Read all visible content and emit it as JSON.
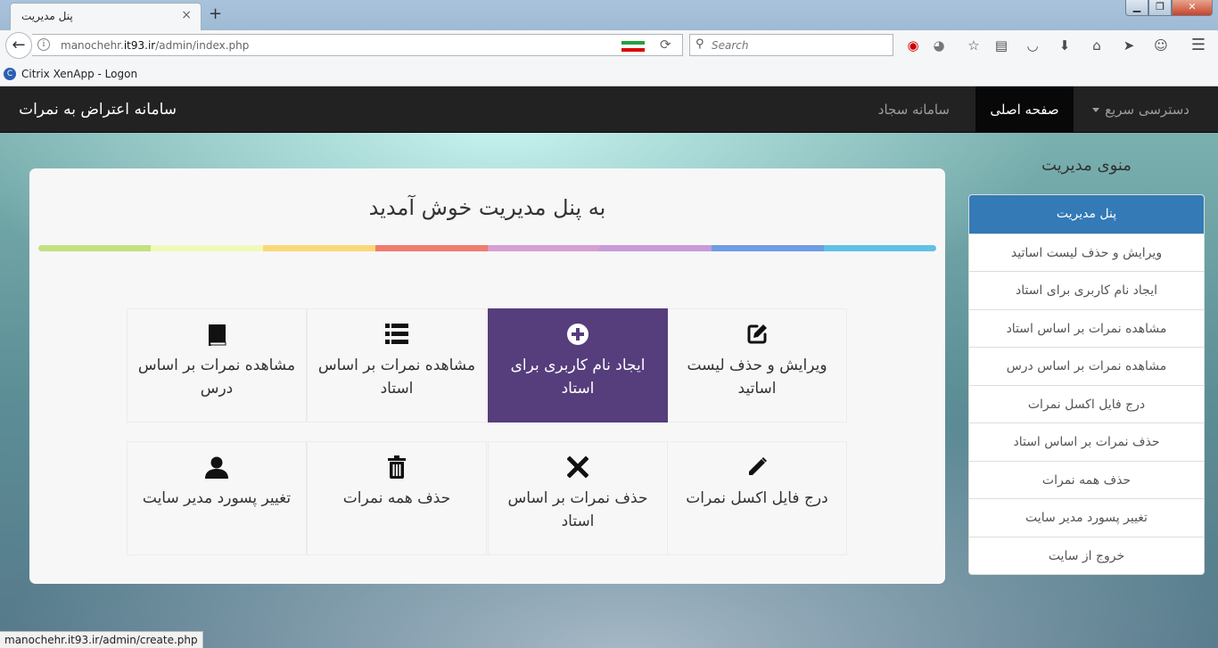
{
  "browser": {
    "tab_title": "پنل مدیریت",
    "tab_close": "×",
    "new_tab": "+",
    "url_host": "manochehr.",
    "url_domain": "it93.ir",
    "url_path": "/admin/index.php",
    "search_placeholder": "Search",
    "bookmark_label": "Citrix XenApp - Logon",
    "status_url": "manochehr.it93.ir/admin/create.php",
    "icons": [
      "back-arrow-icon",
      "info-icon",
      "iran-flag-icon",
      "reload-icon",
      "search-icon",
      "record-icon",
      "extension-icon",
      "star-icon",
      "reading-list-icon",
      "pocket-icon",
      "download-icon",
      "home-icon",
      "send-icon",
      "smiley-icon",
      "hamburger-menu-icon"
    ]
  },
  "site_nav": {
    "brand": "سامانه اعتراض به نمرات",
    "links": {
      "sajjad": "سامانه سجاد",
      "home": "صفحه اصلی",
      "quick_access": "دسترسی سریع"
    }
  },
  "main": {
    "welcome": "به پنل مدیریت خوش آمدید",
    "rainbow_colors": [
      "#c3e17f",
      "#f0f9b8",
      "#fbd876",
      "#ef7d6e",
      "#d79fd3",
      "#c99ad7",
      "#6e9de2",
      "#61c1e4"
    ],
    "tiles": [
      {
        "label": "ویرایش و حذف لیست اساتید",
        "icon": "edit-icon"
      },
      {
        "label": "ایجاد نام کاربری برای استاد",
        "icon": "plus-circle-icon",
        "active": true
      },
      {
        "label": "مشاهده نمرات بر اساس استاد",
        "icon": "list-icon"
      },
      {
        "label": "مشاهده نمرات بر اساس درس",
        "icon": "book-icon"
      },
      {
        "label": "درج فایل اکسل نمرات",
        "icon": "pencil-icon"
      },
      {
        "label": "حذف نمرات بر اساس استاد",
        "icon": "remove-icon"
      },
      {
        "label": "حذف همه نمرات",
        "icon": "trash-icon"
      },
      {
        "label": "تغییر پسورد مدیر سایت",
        "icon": "user-icon"
      }
    ],
    "active_color": "#563d7c"
  },
  "sidebar": {
    "title": "منوی مدیریت",
    "items": [
      "پنل مدیریت",
      "ویرایش و حذف لیست اساتید",
      "ایجاد نام کاربری برای استاد",
      "مشاهده نمرات بر اساس استاد",
      "مشاهده نمرات بر اساس درس",
      "درج فایل اکسل نمرات",
      "حذف نمرات بر اساس استاد",
      "حذف همه نمرات",
      "تغییر پسورد مدیر سایت",
      "خروج از سایت"
    ],
    "active_color": "#337ab7"
  }
}
